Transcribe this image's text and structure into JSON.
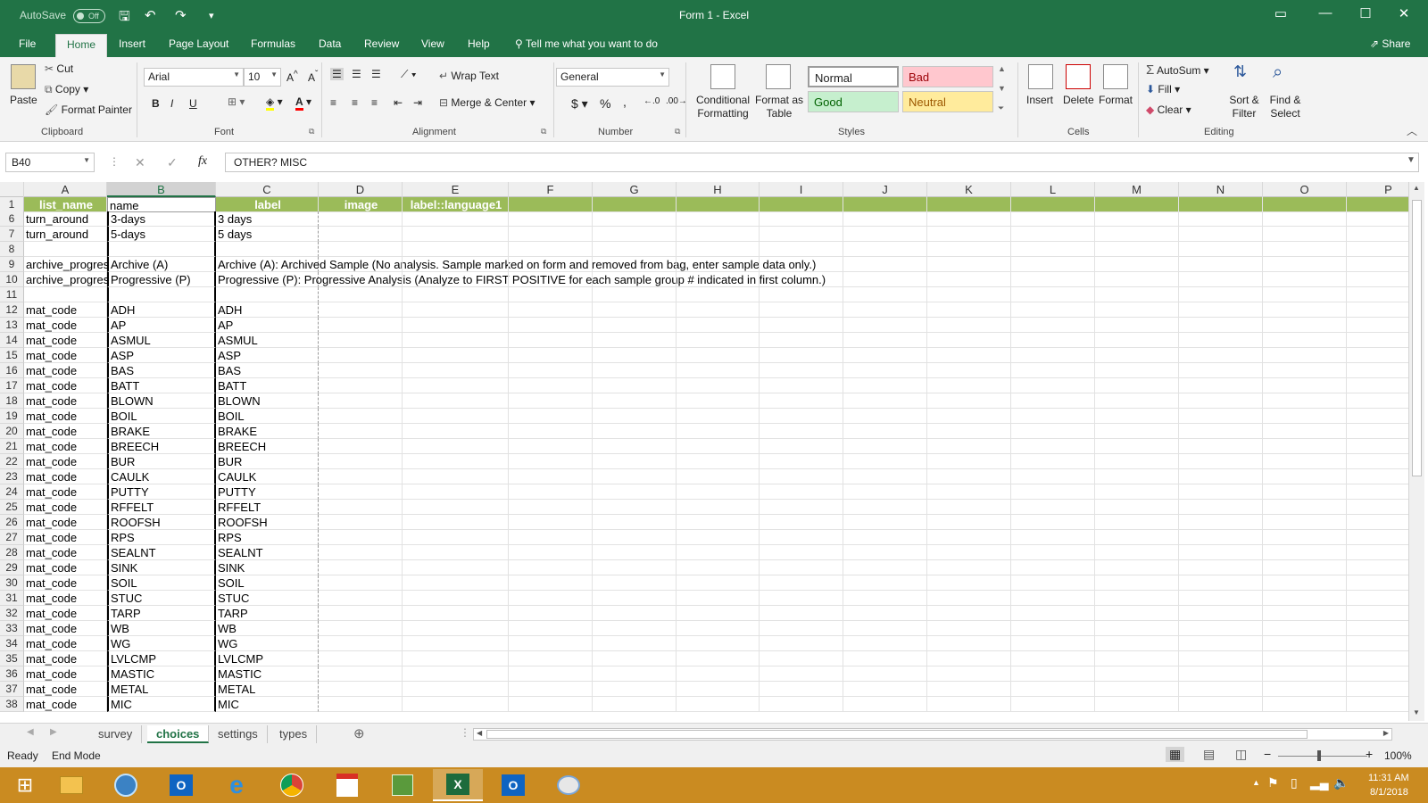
{
  "titlebar": {
    "autosave_label": "AutoSave",
    "autosave_state": "Off",
    "doc_title": "Form 1  -  Excel"
  },
  "ribbon_tabs": [
    "File",
    "Home",
    "Insert",
    "Page Layout",
    "Formulas",
    "Data",
    "Review",
    "View",
    "Help"
  ],
  "tell_me": "Tell me what you want to do",
  "share": "Share",
  "ribbon": {
    "clipboard": {
      "paste": "Paste",
      "cut": "Cut",
      "copy": "Copy",
      "format_painter": "Format Painter",
      "label": "Clipboard"
    },
    "font": {
      "family": "Arial",
      "size": "10",
      "bold": "B",
      "italic": "I",
      "underline": "U",
      "label": "Font"
    },
    "alignment": {
      "wrap_text": "Wrap Text",
      "merge_center": "Merge & Center",
      "label": "Alignment"
    },
    "number": {
      "format": "General",
      "currency": "$",
      "percent": "%",
      "comma": ",",
      "label": "Number"
    },
    "styles": {
      "conditional": "Conditional Formatting",
      "format_as_table": "Format as Table",
      "normal": "Normal",
      "bad": "Bad",
      "good": "Good",
      "neutral": "Neutral",
      "label": "Styles"
    },
    "cells": {
      "insert": "Insert",
      "delete": "Delete",
      "format": "Format",
      "label": "Cells"
    },
    "editing": {
      "autosum": "AutoSum",
      "fill": "Fill",
      "clear": "Clear",
      "sort_filter": "Sort & Filter",
      "find_select": "Find & Select",
      "label": "Editing"
    }
  },
  "formula_bar": {
    "name_box": "B40",
    "cancel": "✕",
    "enter": "✓",
    "fx": "fx",
    "value": "OTHER? MISC"
  },
  "columns": [
    "A",
    "B",
    "C",
    "D",
    "E",
    "F",
    "G",
    "H",
    "I",
    "J",
    "K",
    "L",
    "M",
    "N",
    "O",
    "P"
  ],
  "selected_column": "B",
  "header_row": {
    "num": "1",
    "A": "list_name",
    "B": "name",
    "C": "label",
    "D": "image",
    "E": "label::language1"
  },
  "rows": [
    {
      "num": "6",
      "A": "turn_around",
      "B": "3-days",
      "C": "3 days"
    },
    {
      "num": "7",
      "A": "turn_around",
      "B": "5-days",
      "C": "5 days"
    },
    {
      "num": "8",
      "A": "",
      "B": "",
      "C": ""
    },
    {
      "num": "9",
      "A": "archive_progres",
      "B": "Archive (A)",
      "C": "Archive (A): Archived Sample (No analysis. Sample marked on form and removed from bag, enter sample data only.)"
    },
    {
      "num": "10",
      "A": "archive_progres",
      "B": "Progressive (P)",
      "C": "Progressive (P): Progressive Analysis (Analyze to FIRST POSITIVE for each sample group # indicated in first column.)"
    },
    {
      "num": "11",
      "A": "",
      "B": "",
      "C": ""
    },
    {
      "num": "12",
      "A": "mat_code",
      "B": "ADH",
      "C": "ADH"
    },
    {
      "num": "13",
      "A": "mat_code",
      "B": "AP",
      "C": "AP"
    },
    {
      "num": "14",
      "A": "mat_code",
      "B": "ASMUL",
      "C": "ASMUL"
    },
    {
      "num": "15",
      "A": "mat_code",
      "B": "ASP",
      "C": "ASP"
    },
    {
      "num": "16",
      "A": "mat_code",
      "B": "BAS",
      "C": "BAS"
    },
    {
      "num": "17",
      "A": "mat_code",
      "B": "BATT",
      "C": "BATT"
    },
    {
      "num": "18",
      "A": "mat_code",
      "B": "BLOWN",
      "C": "BLOWN"
    },
    {
      "num": "19",
      "A": "mat_code",
      "B": "BOIL",
      "C": "BOIL"
    },
    {
      "num": "20",
      "A": "mat_code",
      "B": "BRAKE",
      "C": "BRAKE"
    },
    {
      "num": "21",
      "A": "mat_code",
      "B": "BREECH",
      "C": "BREECH"
    },
    {
      "num": "22",
      "A": "mat_code",
      "B": "BUR",
      "C": "BUR"
    },
    {
      "num": "23",
      "A": "mat_code",
      "B": "CAULK",
      "C": "CAULK"
    },
    {
      "num": "24",
      "A": "mat_code",
      "B": "PUTTY",
      "C": "PUTTY"
    },
    {
      "num": "25",
      "A": "mat_code",
      "B": "RFFELT",
      "C": "RFFELT"
    },
    {
      "num": "26",
      "A": "mat_code",
      "B": "ROOFSH",
      "C": "ROOFSH"
    },
    {
      "num": "27",
      "A": "mat_code",
      "B": "RPS",
      "C": "RPS"
    },
    {
      "num": "28",
      "A": "mat_code",
      "B": "SEALNT",
      "C": "SEALNT"
    },
    {
      "num": "29",
      "A": "mat_code",
      "B": "SINK",
      "C": "SINK"
    },
    {
      "num": "30",
      "A": "mat_code",
      "B": "SOIL",
      "C": "SOIL"
    },
    {
      "num": "31",
      "A": "mat_code",
      "B": "STUC",
      "C": "STUC"
    },
    {
      "num": "32",
      "A": "mat_code",
      "B": "TARP",
      "C": "TARP"
    },
    {
      "num": "33",
      "A": "mat_code",
      "B": "WB",
      "C": "WB"
    },
    {
      "num": "34",
      "A": "mat_code",
      "B": "WG",
      "C": "WG"
    },
    {
      "num": "35",
      "A": "mat_code",
      "B": "LVLCMP",
      "C": "LVLCMP"
    },
    {
      "num": "36",
      "A": "mat_code",
      "B": "MASTIC",
      "C": "MASTIC"
    },
    {
      "num": "37",
      "A": "mat_code",
      "B": "METAL",
      "C": "METAL"
    },
    {
      "num": "38",
      "A": "mat_code",
      "B": "MIC",
      "C": "MIC"
    }
  ],
  "sheets": [
    "survey",
    "choices",
    "settings",
    "types"
  ],
  "active_sheet": "choices",
  "status": {
    "ready": "Ready",
    "mode": "End Mode",
    "zoom": "100%"
  },
  "clock": {
    "time": "11:31 AM",
    "date": "8/1/2018"
  },
  "colors": {
    "excel_green": "#217346",
    "header_fill": "#9bbb59",
    "taskbar": "#ca8b21"
  }
}
